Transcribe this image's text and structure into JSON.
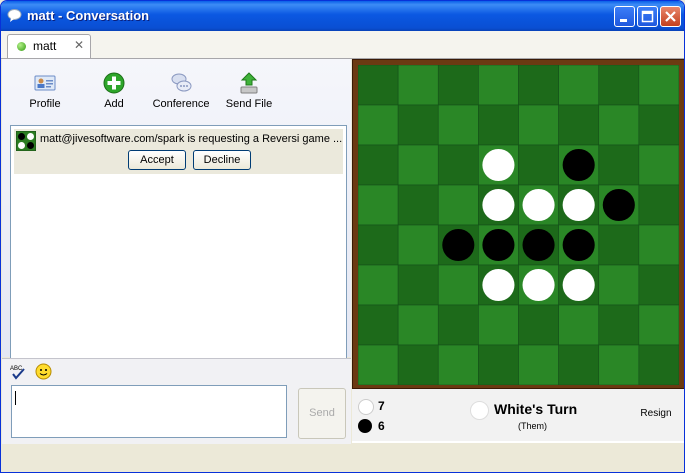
{
  "window": {
    "title": "matt - Conversation"
  },
  "tab": {
    "label": "matt",
    "close": "✕"
  },
  "toolbar": [
    {
      "label": "Profile",
      "icon": "profile-card-icon"
    },
    {
      "label": "Add",
      "icon": "add-plus-icon"
    },
    {
      "label": "Conference",
      "icon": "conference-bubbles-icon"
    },
    {
      "label": "Send File",
      "icon": "send-file-icon"
    }
  ],
  "request": {
    "text": "matt@jivesoftware.com/spark is requesting a Reversi game ...",
    "accept_label": "Accept",
    "decline_label": "Decline"
  },
  "input": {
    "value": ""
  },
  "send_label": "Send",
  "game": {
    "board": [
      [
        0,
        0,
        0,
        0,
        0,
        0,
        0,
        0
      ],
      [
        0,
        0,
        0,
        0,
        0,
        0,
        0,
        0
      ],
      [
        0,
        0,
        0,
        1,
        0,
        2,
        0,
        0
      ],
      [
        0,
        0,
        0,
        1,
        1,
        1,
        2,
        0
      ],
      [
        0,
        0,
        2,
        2,
        2,
        2,
        0,
        0
      ],
      [
        0,
        0,
        0,
        1,
        1,
        1,
        0,
        0
      ],
      [
        0,
        0,
        0,
        0,
        0,
        0,
        0,
        0
      ],
      [
        0,
        0,
        0,
        0,
        0,
        0,
        0,
        0
      ]
    ],
    "white_count": "7",
    "black_count": "6",
    "turn_text": "White's Turn",
    "turn_sub": "(Them)",
    "resign_label": "Resign"
  }
}
